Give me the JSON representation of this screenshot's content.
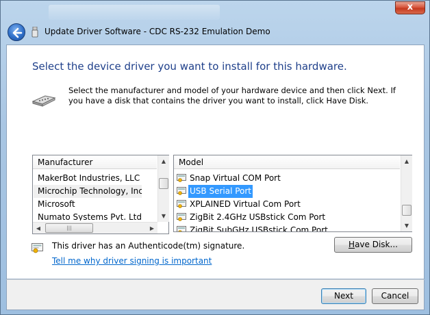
{
  "window": {
    "title": "Update Driver Software - CDC RS-232 Emulation Demo",
    "close_glyph": "x"
  },
  "header": {
    "heading": "Select the device driver you want to install for this hardware.",
    "instruction": "Select the manufacturer and model of your hardware device and then click Next. If you have a disk that contains the driver you want to install, click Have Disk."
  },
  "manufacturer": {
    "header": "Manufacturer",
    "items": [
      "MakerBot Industries, LLC",
      "Microchip Technology, Inc.",
      "Microsoft",
      "Numato Systems Pvt. Ltd"
    ],
    "selected_index": 1
  },
  "model": {
    "header": "Model",
    "items": [
      "Snap Virtual COM Port",
      "USB Serial Port",
      "XPLAINED Virtual Com Port",
      "ZigBit 2.4GHz USBstick Com Port",
      "ZigBit SubGHz USBstick Com Port"
    ],
    "selected_index": 1
  },
  "signature": {
    "text": "This driver has an Authenticode(tm) signature.",
    "link": "Tell me why driver signing is important"
  },
  "buttons": {
    "have_disk_mnemonic": "H",
    "have_disk_rest": "ave Disk...",
    "next": "Next",
    "cancel": "Cancel"
  },
  "icons": {
    "back": "back-arrow-icon",
    "device": "serial-port-device-icon",
    "driver": "certified-driver-icon",
    "signature": "certificate-icon"
  }
}
